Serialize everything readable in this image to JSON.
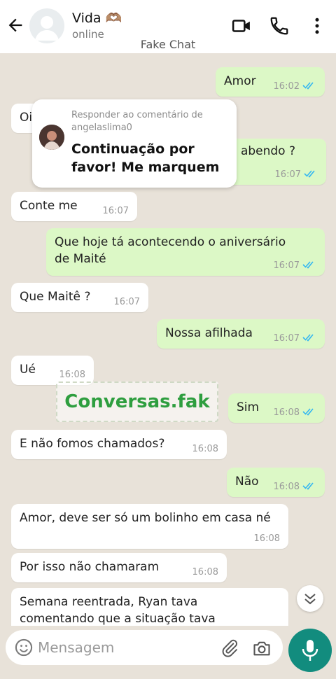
{
  "header": {
    "contact_name": "Vida 🫶🏽",
    "status": "online",
    "subtitle": "Fake Chat"
  },
  "overlay": {
    "label": "Responder ao comentário de angelaslima0",
    "text": "Continuação por favor! Me marquem"
  },
  "watermark": "Conversas.fak",
  "messages": [
    {
      "side": "out",
      "text": "Amor",
      "time": "16:02",
      "read": true
    },
    {
      "side": "in",
      "text": "Oi",
      "time": ""
    },
    {
      "side": "out",
      "text": "abendo ?",
      "time": "16:07",
      "read": true
    },
    {
      "side": "in",
      "text": "Conte me",
      "time": "16:07"
    },
    {
      "side": "out",
      "text": "Que hoje tá acontecendo o aniversário de Maité",
      "time": "16:07",
      "read": true
    },
    {
      "side": "in",
      "text": "Que Maitê ?",
      "time": "16:07"
    },
    {
      "side": "out",
      "text": "Nossa afilhada",
      "time": "16:07",
      "read": true
    },
    {
      "side": "in",
      "text": "Ué",
      "time": "16:08"
    },
    {
      "side": "out",
      "text": "Sim",
      "time": "16:08",
      "read": true
    },
    {
      "side": "in",
      "text": "E não fomos chamados?",
      "time": "16:08"
    },
    {
      "side": "out",
      "text": "Não",
      "time": "16:08",
      "read": true
    },
    {
      "side": "in",
      "text": "Amor, deve ser só um bolinho em casa né",
      "time": "16:08"
    },
    {
      "side": "in",
      "text": "Por isso não chamaram",
      "time": "16:08"
    },
    {
      "side": "in",
      "text": "Semana reentrada, Ryan tava comentando que a situação tava",
      "time": ""
    }
  ],
  "composer": {
    "placeholder": "Mensagem",
    "value": ""
  },
  "colors": {
    "outgoing_bubble": "#dcf8c6",
    "incoming_bubble": "#ffffff",
    "read_ticks": "#34b7f1",
    "accent": "#128c7e",
    "watermark": "#2e9e3f"
  },
  "icons": [
    "back-arrow-icon",
    "video-call-icon",
    "phone-icon",
    "more-options-icon",
    "emoji-icon",
    "attach-icon",
    "camera-icon",
    "mic-icon",
    "chevrons-down-icon"
  ]
}
